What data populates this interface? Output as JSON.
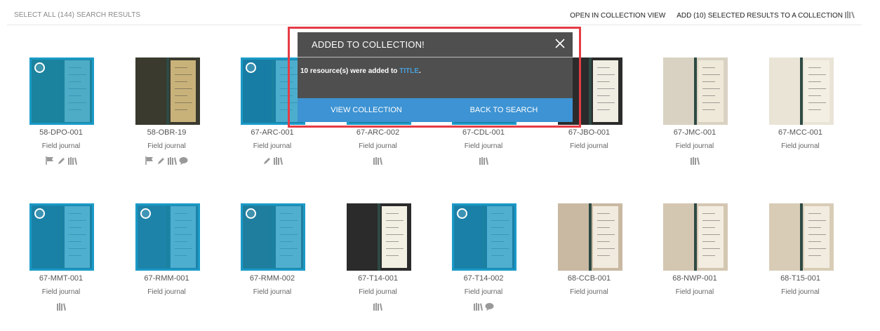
{
  "toolbar": {
    "select_all": "SELECT ALL (144) SEARCH RESULTS",
    "open_collection_view": "OPEN IN COLLECTION VIEW",
    "add_selected": "ADD (10) SELECTED RESULTS TO A COLLECTION"
  },
  "modal": {
    "title": "ADDED TO COLLECTION!",
    "message_prefix": "10 resource(s) were added to ",
    "message_link": "TITLE",
    "message_suffix": ".",
    "view_collection": "VIEW COLLECTION",
    "back_to_search": "BACK TO SEARCH"
  },
  "results": [
    {
      "id": "58-DPO-001",
      "type": "Field journal",
      "selected": true,
      "icons": [
        "flag-icon",
        "pencil-icon",
        "library-icon"
      ]
    },
    {
      "id": "58-OBR-19",
      "type": "Field journal",
      "selected": false,
      "icons": [
        "flag-icon",
        "pencil-icon",
        "library-icon",
        "comment-icon"
      ]
    },
    {
      "id": "67-ARC-001",
      "type": "Field journal",
      "selected": true,
      "icons": [
        "pencil-icon",
        "library-icon"
      ]
    },
    {
      "id": "67-ARC-002",
      "type": "Field journal",
      "selected": true,
      "icons": [
        "library-icon"
      ]
    },
    {
      "id": "67-CDL-001",
      "type": "Field journal",
      "selected": true,
      "icons": [
        "library-icon"
      ]
    },
    {
      "id": "67-JBO-001",
      "type": "Field journal",
      "selected": false,
      "icons": []
    },
    {
      "id": "67-JMC-001",
      "type": "Field journal",
      "selected": false,
      "icons": [
        "library-icon"
      ]
    },
    {
      "id": "67-MCC-001",
      "type": "Field journal",
      "selected": false,
      "icons": []
    },
    {
      "id": "67-MMT-001",
      "type": "Field journal",
      "selected": true,
      "icons": [
        "library-icon"
      ]
    },
    {
      "id": "67-RMM-001",
      "type": "Field journal",
      "selected": true,
      "icons": []
    },
    {
      "id": "67-RMM-002",
      "type": "Field journal",
      "selected": true,
      "icons": []
    },
    {
      "id": "67-T14-001",
      "type": "Field journal",
      "selected": false,
      "icons": [
        "library-icon"
      ]
    },
    {
      "id": "67-T14-002",
      "type": "Field journal",
      "selected": true,
      "icons": [
        "library-icon",
        "comment-icon"
      ]
    },
    {
      "id": "68-CCB-001",
      "type": "Field journal",
      "selected": false,
      "icons": []
    },
    {
      "id": "68-NWP-001",
      "type": "Field journal",
      "selected": false,
      "icons": []
    },
    {
      "id": "68-T15-001",
      "type": "Field journal",
      "selected": false,
      "icons": []
    }
  ],
  "colors": {
    "selected_overlay": "#1397c4",
    "highlight_border": "#e63c45",
    "modal_bg": "#4f4f4f",
    "modal_actions_bg": "#3d93d3",
    "link": "#4a9fd9"
  }
}
